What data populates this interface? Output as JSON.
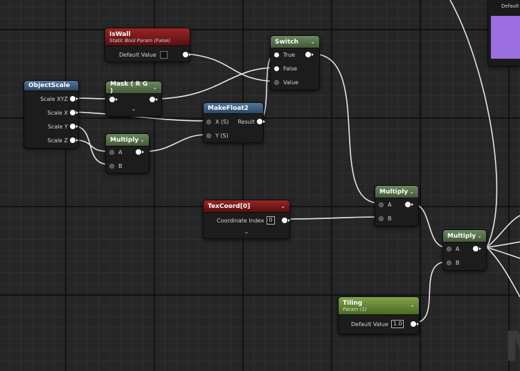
{
  "nodes": {
    "iswall": {
      "title": "IsWall",
      "subtitle": "Static Bool Param (False)",
      "default_label": "Default Value"
    },
    "switch": {
      "title": "Switch",
      "pins": [
        "True",
        "False",
        "Value"
      ]
    },
    "objectscale": {
      "title": "ObjectScale",
      "outputs": [
        "Scale XYZ",
        "Scale X",
        "Scale Y",
        "Scale Z"
      ]
    },
    "mask": {
      "title": "Mask ( R G )"
    },
    "makefloat2": {
      "title": "MakeFloat2",
      "inputs": [
        "X (S)",
        "Y (S)"
      ],
      "output": "Result"
    },
    "multiply1": {
      "title": "Multiply",
      "inputs": [
        "A",
        "B"
      ]
    },
    "texcoord": {
      "title": "TexCoord[0]",
      "label": "Coordinate Index",
      "value": "0"
    },
    "multiply2": {
      "title": "Multiply",
      "inputs": [
        "A",
        "B"
      ]
    },
    "multiply3": {
      "title": "Multiply",
      "inputs": [
        "A",
        "B"
      ]
    },
    "tiling": {
      "title": "Tiling",
      "subtitle": "Param (1)",
      "default_label": "Default Value",
      "value": "1.0"
    },
    "preview": {
      "label": "Default",
      "color": "#9b6fe0"
    }
  },
  "colors": {
    "bg": "#262626",
    "wire": "#ffffff"
  },
  "icons": {
    "expand": "chevron-down-icon"
  }
}
